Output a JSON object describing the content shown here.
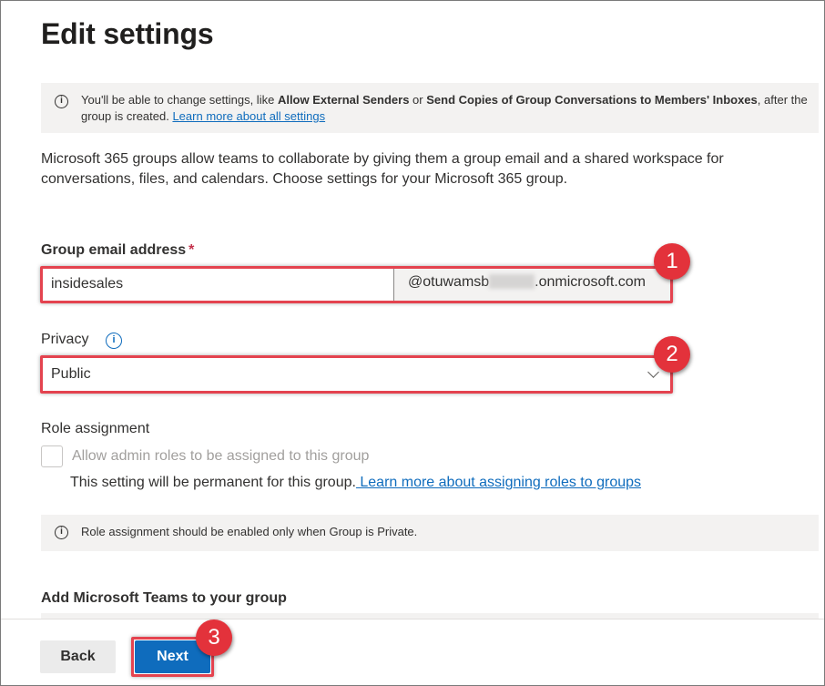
{
  "page": {
    "title": "Edit settings"
  },
  "info_banner": {
    "icon": "info-icon",
    "text_prefix": "You'll be able to change settings, like ",
    "bold_1": "Allow External Senders",
    "text_mid": " or ",
    "bold_2": "Send Copies of Group Conversations to Members' Inboxes",
    "text_suffix": ", after the group is created. ",
    "link": "Learn more about all settings"
  },
  "description": "Microsoft 365 groups allow teams to collaborate by giving them a group email and a shared workspace for conversations, files, and calendars. Choose settings for your Microsoft 365 group.",
  "email": {
    "label": "Group email address",
    "required_mark": "*",
    "value": "insidesales",
    "domain_prefix": "@otuwamsb",
    "domain_suffix": ".onmicrosoft.com"
  },
  "privacy": {
    "label": "Privacy",
    "info_icon": "i",
    "selected": "Public"
  },
  "role_assignment": {
    "heading": "Role assignment",
    "checkbox_label": "Allow admin roles to be assigned to this group",
    "checked": false,
    "note": "This setting will be permanent for this group.",
    "note_link": " Learn more about assigning roles to groups",
    "info_text": "Role assignment should be enabled only when Group is Private."
  },
  "teams": {
    "heading": "Add Microsoft Teams to your group"
  },
  "callouts": [
    "1",
    "2",
    "3"
  ],
  "footer": {
    "back_label": "Back",
    "next_label": "Next"
  },
  "colors": {
    "accent": "#0f6cbd",
    "highlight": "#e4434f",
    "badge": "#e3323b"
  }
}
